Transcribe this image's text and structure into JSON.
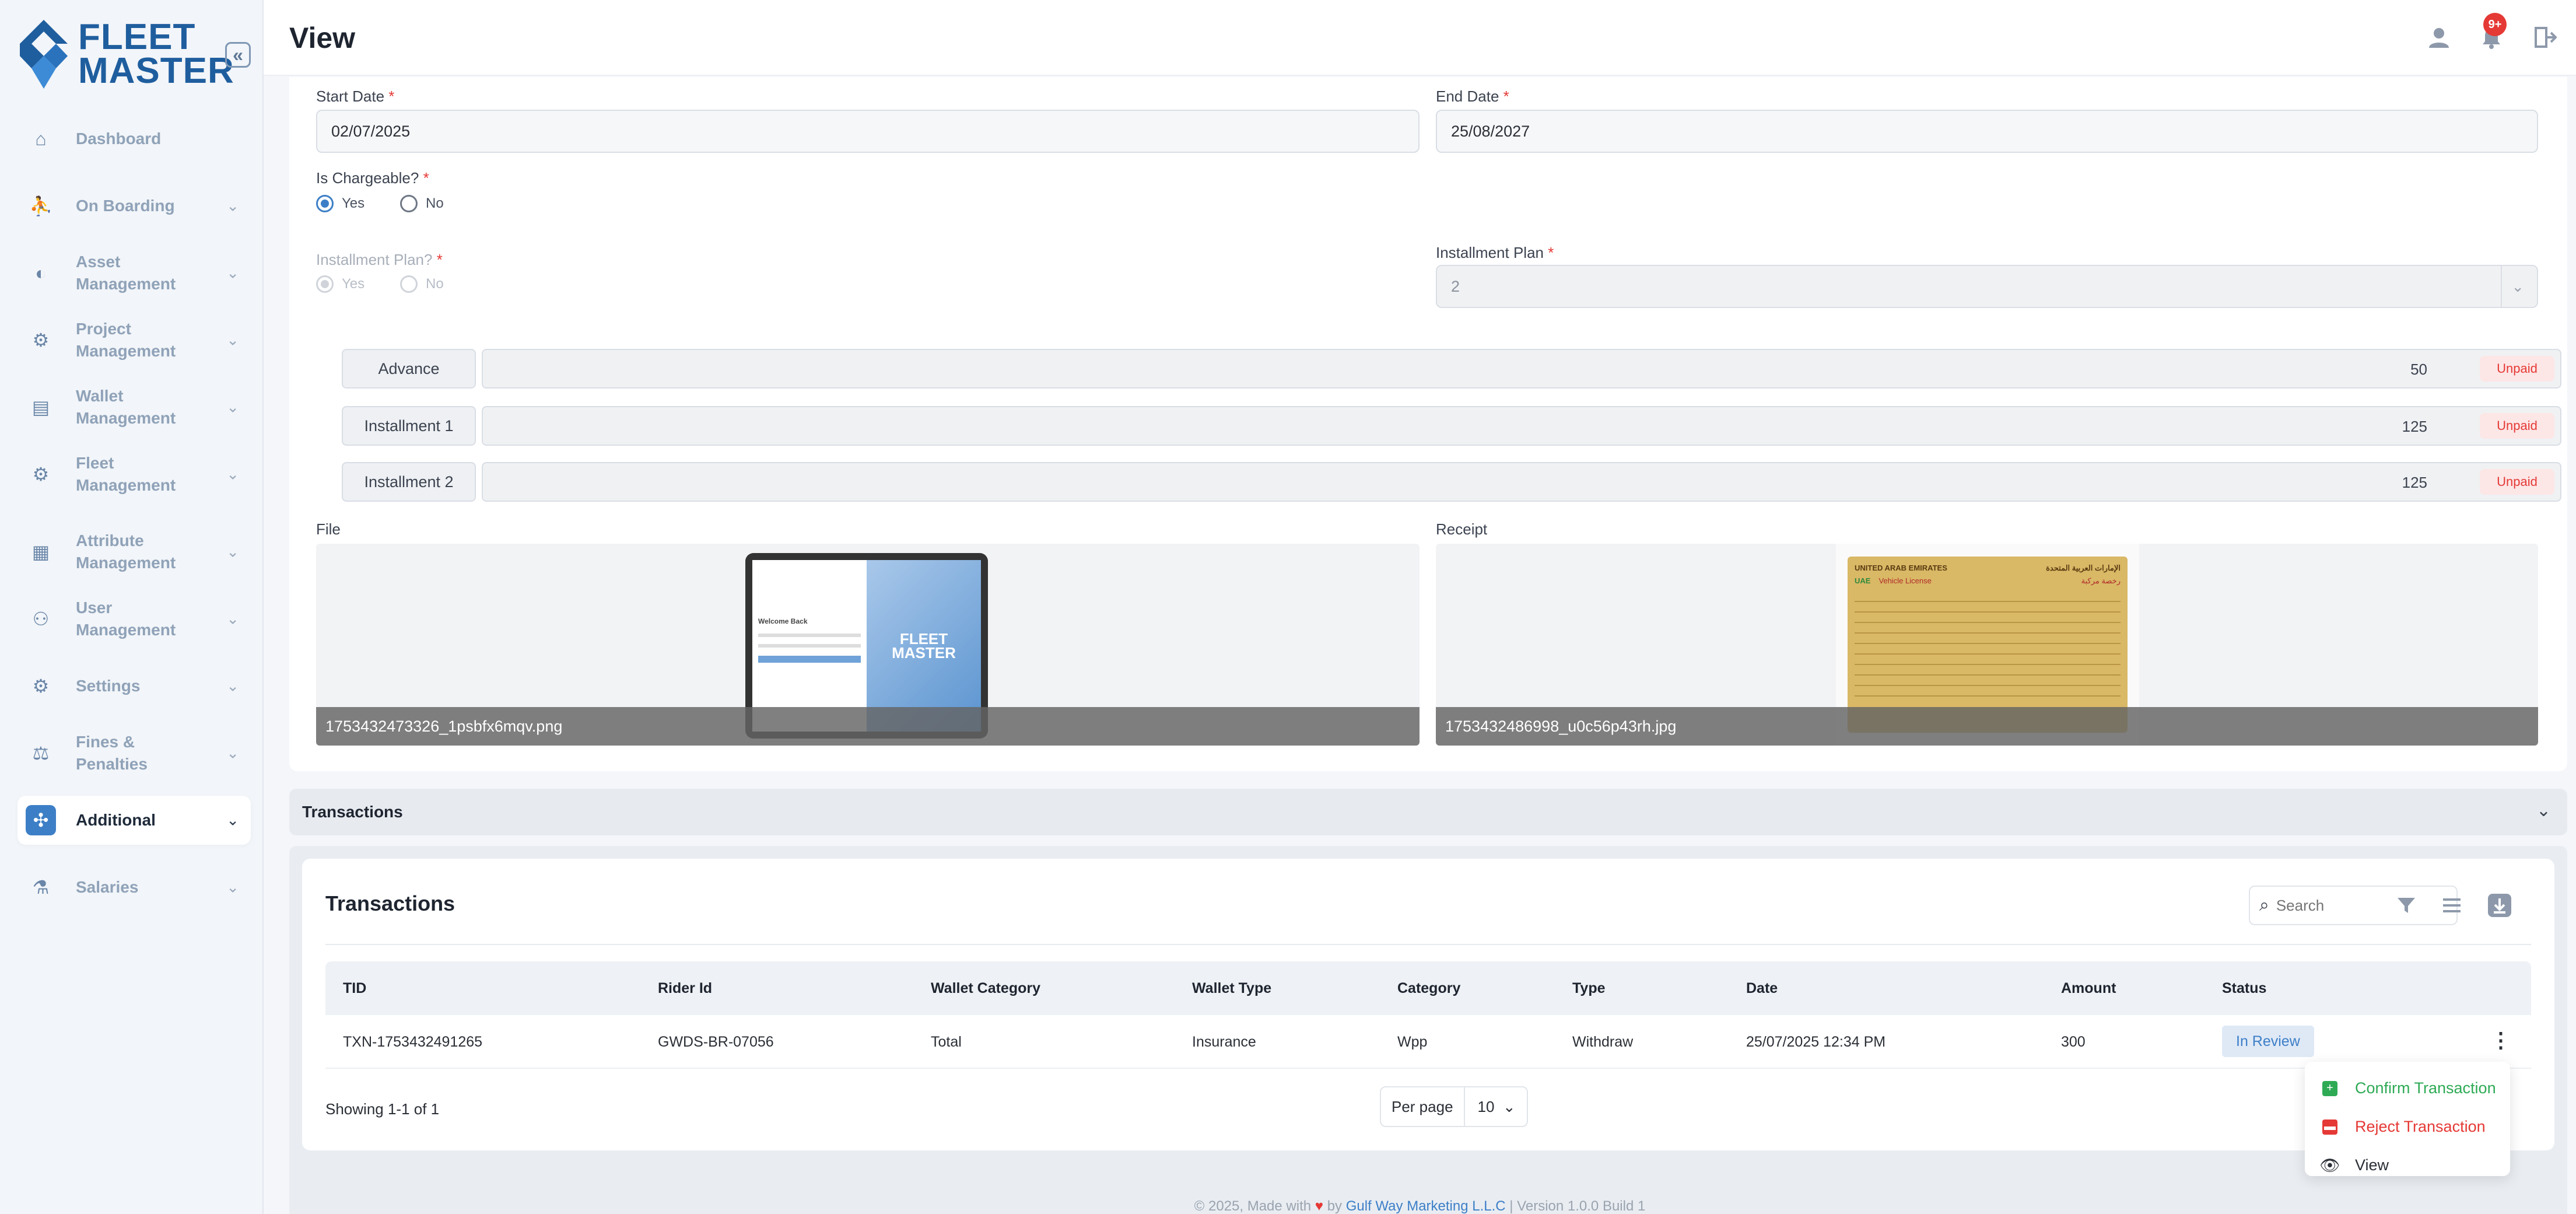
{
  "brand": {
    "line1": "FLEET",
    "line2": "MASTER"
  },
  "header": {
    "title": "View",
    "notification_count": "9+"
  },
  "sidebar": {
    "items": [
      {
        "label": "Dashboard",
        "icon": "home-icon"
      },
      {
        "label": "On Boarding",
        "icon": "onboarding-icon"
      },
      {
        "label": "Asset Management",
        "icon": "asset-icon"
      },
      {
        "label": "Project Management",
        "icon": "project-icon"
      },
      {
        "label": "Wallet Management",
        "icon": "wallet-icon"
      },
      {
        "label": "Fleet Management",
        "icon": "fleet-icon"
      },
      {
        "label": "Attribute Management",
        "icon": "attribute-icon"
      },
      {
        "label": "User Management",
        "icon": "users-icon"
      },
      {
        "label": "Settings",
        "icon": "gear-icon"
      },
      {
        "label": "Fines & Penalties",
        "icon": "fines-icon"
      },
      {
        "label": "Additional",
        "icon": "additional-icon"
      },
      {
        "label": "Salaries",
        "icon": "salaries-icon"
      }
    ]
  },
  "form": {
    "start_date_label": "Start Date",
    "start_date": "02/07/2025",
    "end_date_label": "End Date",
    "end_date": "25/08/2027",
    "chargeable_label": "Is Chargeable?",
    "chargeable_yes": "Yes",
    "chargeable_no": "No",
    "installment_plan_q_label": "Installment Plan?",
    "installment_yes": "Yes",
    "installment_no": "No",
    "installment_plan_label": "Installment Plan",
    "installment_plan_value": "2",
    "installments": [
      {
        "label": "Advance",
        "amount": "50",
        "status": "Unpaid"
      },
      {
        "label": "Installment 1",
        "amount": "125",
        "status": "Unpaid"
      },
      {
        "label": "Installment 2",
        "amount": "125",
        "status": "Unpaid"
      }
    ],
    "file_label": "File",
    "file_name": "1753432473326_1psbfx6mqv.png",
    "receipt_label": "Receipt",
    "receipt_name": "1753432486998_u0c56p43rh.jpg",
    "file_thumb": {
      "welcome": "Welcome Back",
      "brand1": "FLEET",
      "brand2": "MASTER"
    },
    "receipt_thumb": {
      "country": "UNITED ARAB EMIRATES",
      "country_ar": "الإمارات العربية المتحدة",
      "uae": "UAE",
      "doc": "Vehicle License",
      "doc_ar": "رخصة مركبة"
    }
  },
  "accordion": {
    "title": "Transactions"
  },
  "transactions": {
    "title": "Transactions",
    "search_placeholder": "Search",
    "columns": [
      "TID",
      "Rider Id",
      "Wallet Category",
      "Wallet Type",
      "Category",
      "Type",
      "Date",
      "Amount",
      "Status"
    ],
    "rows": [
      {
        "tid": "TXN-1753432491265",
        "rider_id": "GWDS-BR-07056",
        "wallet_category": "Total",
        "wallet_type": "Insurance",
        "category": "Wpp",
        "type": "Withdraw",
        "date": "25/07/2025 12:34 PM",
        "amount": "300",
        "status": "In Review"
      }
    ],
    "showing": "Showing 1-1 of 1",
    "per_page_label": "Per page",
    "per_page_value": "10"
  },
  "row_menu": {
    "items": [
      {
        "label": "Confirm Transaction",
        "color": "#2eaa55"
      },
      {
        "label": "Reject Transaction",
        "color": "#e53935"
      },
      {
        "label": "View",
        "color": "#2b2f36"
      }
    ]
  },
  "footer": {
    "prefix": "© 2025, Made with",
    "by": "by",
    "company": "Gulf Way Marketing L.L.C",
    "version": "| Version 1.0.0 Build 1"
  }
}
